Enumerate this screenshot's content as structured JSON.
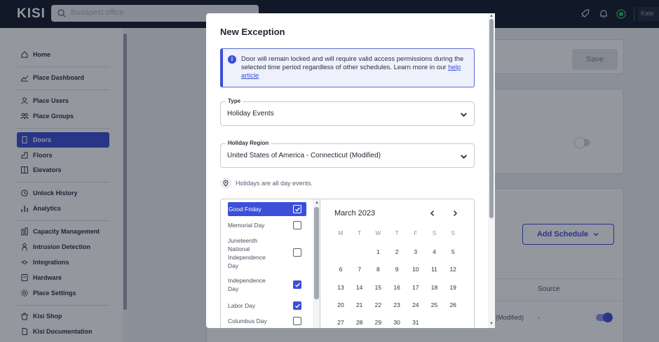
{
  "app": {
    "logo": "KISI",
    "search_text": "Budapest office",
    "user_chip": "Kate"
  },
  "sidebar": {
    "items": [
      {
        "label": "Home",
        "icon": "home-icon"
      },
      {
        "label": "Place Dashboard",
        "icon": "chart-icon"
      },
      {
        "label": "Place Users",
        "icon": "user-icon"
      },
      {
        "label": "Place Groups",
        "icon": "group-icon"
      },
      {
        "label": "Doors",
        "icon": "door-icon"
      },
      {
        "label": "Floors",
        "icon": "floor-icon"
      },
      {
        "label": "Elevators",
        "icon": "elevator-icon"
      },
      {
        "label": "Unlock History",
        "icon": "history-icon"
      },
      {
        "label": "Analytics",
        "icon": "bar-chart-icon"
      },
      {
        "label": "Capacity Management",
        "icon": "capacity-icon"
      },
      {
        "label": "Intrusion Detection",
        "icon": "intrusion-icon"
      },
      {
        "label": "Integrations",
        "icon": "plug-icon"
      },
      {
        "label": "Hardware",
        "icon": "hardware-icon"
      },
      {
        "label": "Place Settings",
        "icon": "gear-icon"
      },
      {
        "label": "Kisi Shop",
        "icon": "shop-icon"
      },
      {
        "label": "Kisi Documentation",
        "icon": "doc-icon"
      }
    ],
    "active": "Doors"
  },
  "background": {
    "save_label": "Save",
    "add_schedule_label": "Add Schedule",
    "source_header": "Source",
    "row_modified": "(Modified)",
    "row_dash": "-"
  },
  "modal": {
    "title": "New Exception",
    "info_text": "Door will remain locked and will require valid access permissions during the selected time period regardless of other schedules. Learn more in our ",
    "info_link": "help article",
    "type_label": "Type",
    "type_value": "Holiday Events",
    "region_label": "Holiday Region",
    "region_value": "United States of America - Connecticut (Modified)",
    "hint": "Holidays are all day events.",
    "holidays": [
      {
        "name": "Good Friday",
        "checked": true,
        "selected": true
      },
      {
        "name": "Memorial Day",
        "checked": false,
        "selected": false
      },
      {
        "name": "Juneteenth National Independence Day",
        "checked": false,
        "selected": false
      },
      {
        "name": "Independence Day",
        "checked": true,
        "selected": false
      },
      {
        "name": "Labor Day",
        "checked": true,
        "selected": false
      },
      {
        "name": "Columbus Day",
        "checked": false,
        "selected": false
      }
    ],
    "calendar": {
      "month_label": "March 2023",
      "weekdays": [
        "M",
        "T",
        "W",
        "T",
        "F",
        "S",
        "S"
      ],
      "weeks": [
        [
          "",
          "",
          "1",
          "2",
          "3",
          "4",
          "5"
        ],
        [
          "6",
          "7",
          "8",
          "9",
          "10",
          "11",
          "12"
        ],
        [
          "13",
          "14",
          "15",
          "16",
          "17",
          "18",
          "19"
        ],
        [
          "20",
          "21",
          "22",
          "23",
          "24",
          "25",
          "26"
        ],
        [
          "27",
          "28",
          "29",
          "30",
          "31",
          "",
          ""
        ]
      ]
    }
  },
  "colors": {
    "accent": "#3b4fd8",
    "topbar": "#111827",
    "status_green": "#22c55e"
  }
}
